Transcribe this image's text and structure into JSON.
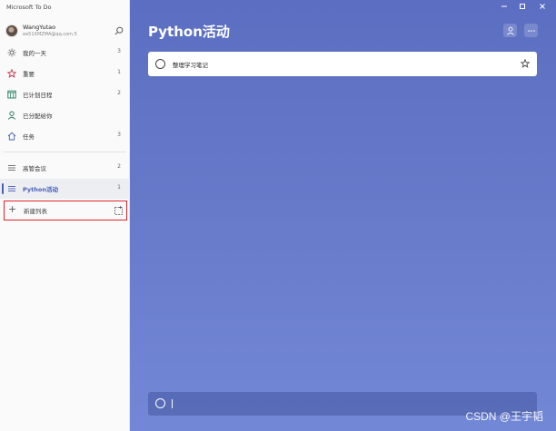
{
  "app": {
    "title": "Microsoft To Do"
  },
  "profile": {
    "name": "WangYutao",
    "email": "ee51XMZMA@qq.com.5"
  },
  "sidebar": {
    "items": [
      {
        "label": "我的一天",
        "count": "3",
        "icon": "sun-icon"
      },
      {
        "label": "重要",
        "count": "1",
        "icon": "star-icon"
      },
      {
        "label": "已计划日程",
        "count": "2",
        "icon": "calendar-icon"
      },
      {
        "label": "已分配给你",
        "count": "",
        "icon": "person-icon"
      },
      {
        "label": "任务",
        "count": "3",
        "icon": "home-icon"
      }
    ],
    "lists": [
      {
        "label": "高管会议",
        "count": "2",
        "icon": "list-icon"
      },
      {
        "label": "Python活动",
        "count": "1",
        "icon": "list-icon",
        "active": true
      }
    ],
    "new_list_label": "新建列表"
  },
  "main": {
    "title": "Python活动",
    "tasks": [
      {
        "title": "整理学习笔记",
        "starred": false
      }
    ],
    "add_task_placeholder": ""
  },
  "watermark": "CSDN @王宇韬",
  "colors": {
    "accent": "#4a5fb8",
    "background_top": "#5b6ec1",
    "background_bottom": "#7288d6",
    "highlight_border": "#e0242b"
  }
}
